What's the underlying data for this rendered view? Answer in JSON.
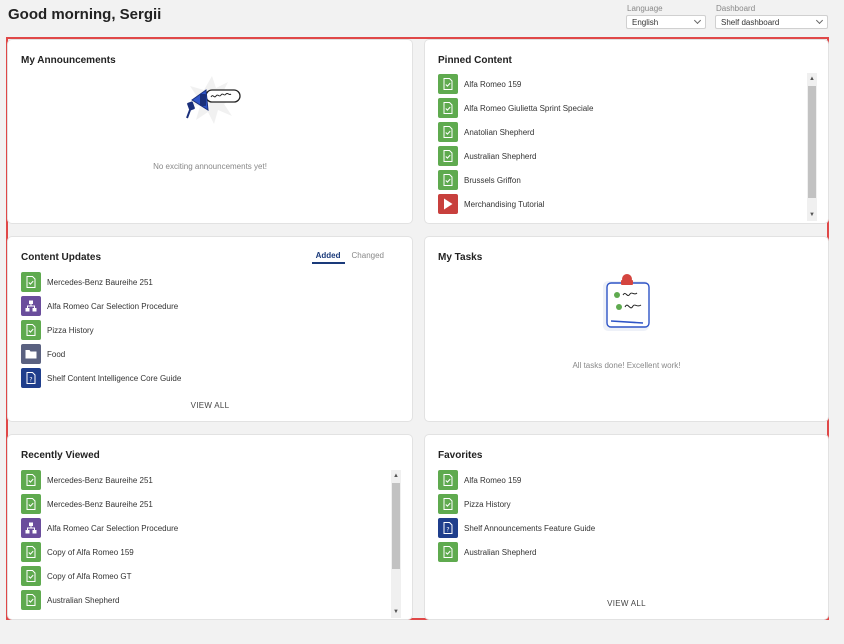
{
  "header": {
    "greeting": "Good morning, Sergii",
    "language": {
      "label": "Language",
      "value": "English"
    },
    "dashboard": {
      "label": "Dashboard",
      "value": "Shelf dashboard"
    }
  },
  "colors": {
    "doc_green": "#5faa4f",
    "flow_purple": "#6a4d9c",
    "folder_gray": "#5a6180",
    "guide_blue": "#1f3e8c",
    "video_red": "#c8403d",
    "frame_red": "#e04848"
  },
  "announcements": {
    "title": "My Announcements",
    "empty_text": "No exciting announcements yet!"
  },
  "pinned": {
    "title": "Pinned Content",
    "items": [
      {
        "label": "Alfa Romeo 159",
        "icon": "document-icon"
      },
      {
        "label": "Alfa Romeo Giulietta Sprint Speciale",
        "icon": "document-icon"
      },
      {
        "label": "Anatolian Shepherd",
        "icon": "document-icon"
      },
      {
        "label": "Australian Shepherd",
        "icon": "document-icon"
      },
      {
        "label": "Brussels Griffon",
        "icon": "document-icon"
      },
      {
        "label": "Merchandising Tutorial",
        "icon": "video-icon"
      }
    ]
  },
  "updates": {
    "title": "Content Updates",
    "tabs": [
      "Added",
      "Changed"
    ],
    "items": [
      {
        "label": "Mercedes-Benz Baureihe 251",
        "icon": "document-icon"
      },
      {
        "label": "Alfa Romeo Car Selection Procedure",
        "icon": "flowchart-icon"
      },
      {
        "label": "Pizza History",
        "icon": "document-icon"
      },
      {
        "label": "Food",
        "icon": "folder-icon"
      },
      {
        "label": "Shelf Content Intelligence Core Guide",
        "icon": "guide-icon"
      }
    ],
    "view_all": "VIEW ALL"
  },
  "tasks": {
    "title": "My Tasks",
    "empty_text": "All tasks done! Excellent work!"
  },
  "recent": {
    "title": "Recently Viewed",
    "items": [
      {
        "label": "Mercedes-Benz Baureihe 251",
        "icon": "document-icon"
      },
      {
        "label": "Mercedes-Benz Baureihe 251",
        "icon": "document-icon"
      },
      {
        "label": "Alfa Romeo Car Selection Procedure",
        "icon": "flowchart-icon"
      },
      {
        "label": "Copy of Alfa Romeo 159",
        "icon": "document-icon"
      },
      {
        "label": "Copy of Alfa Romeo GT",
        "icon": "document-icon"
      },
      {
        "label": "Australian Shepherd",
        "icon": "document-icon"
      }
    ]
  },
  "favorites": {
    "title": "Favorites",
    "items": [
      {
        "label": "Alfa Romeo 159",
        "icon": "document-icon"
      },
      {
        "label": "Pizza History",
        "icon": "document-icon"
      },
      {
        "label": "Shelf Announcements Feature Guide",
        "icon": "guide-icon"
      },
      {
        "label": "Australian Shepherd",
        "icon": "document-icon"
      }
    ],
    "view_all": "VIEW ALL"
  }
}
